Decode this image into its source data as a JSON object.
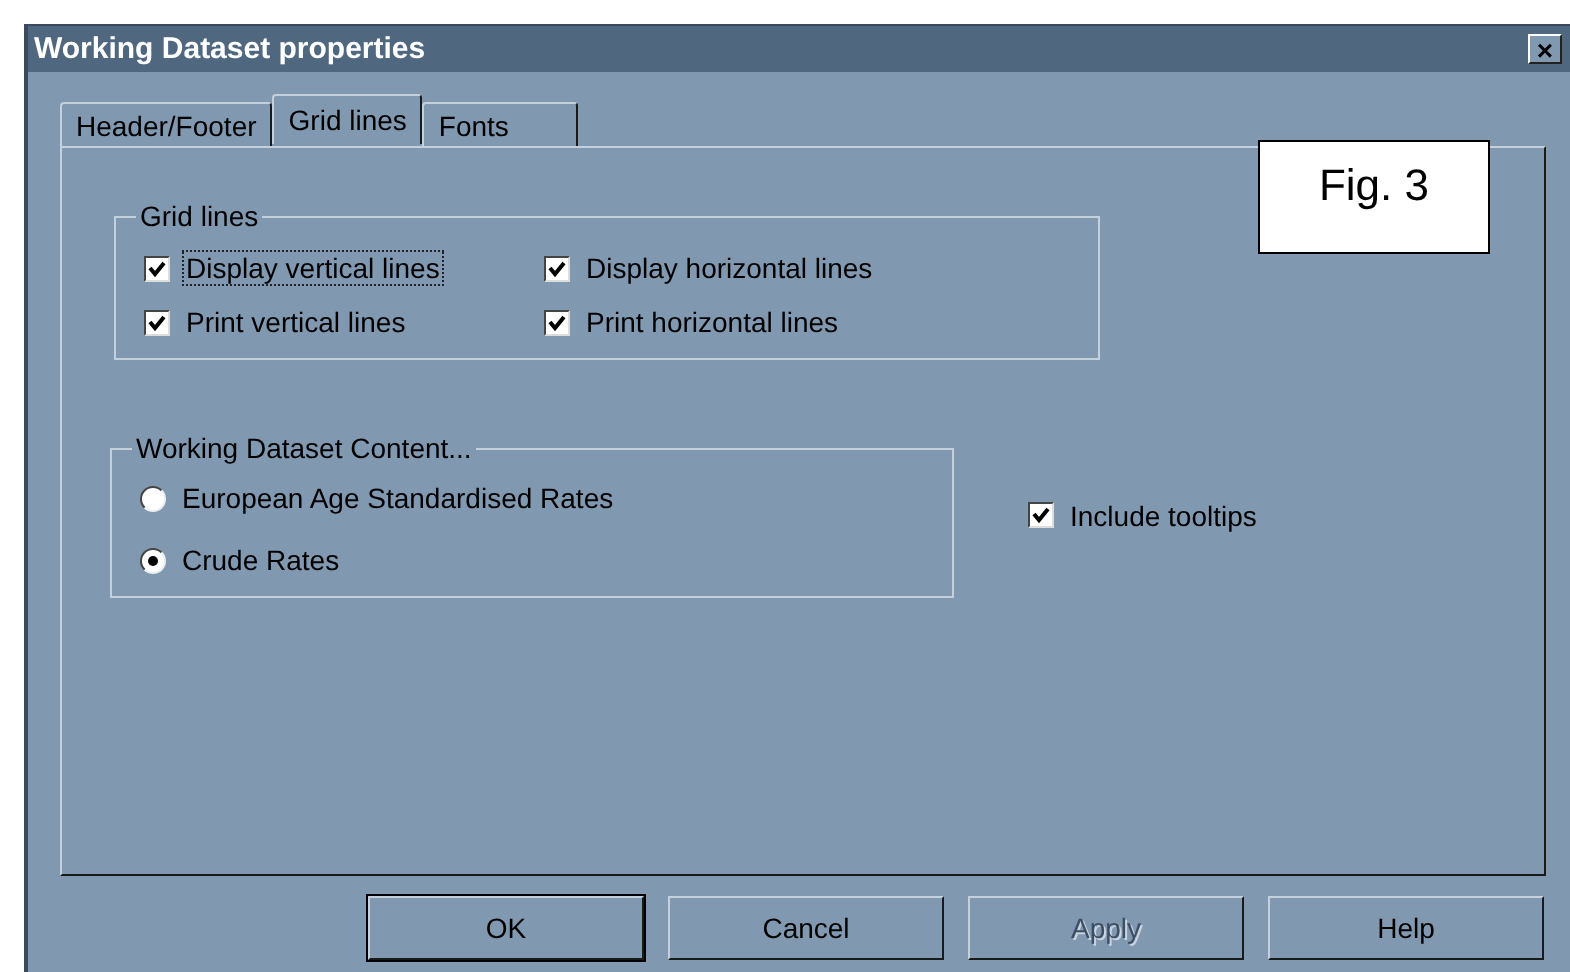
{
  "window": {
    "title": "Working Dataset properties",
    "close": "×"
  },
  "tabs": [
    {
      "label": "Header/Footer",
      "selected": false
    },
    {
      "label": "Grid lines",
      "selected": true
    },
    {
      "label": "Fonts",
      "selected": false
    }
  ],
  "figure_label": "Fig. 3",
  "grid_lines": {
    "title": "Grid lines",
    "options": [
      {
        "label": "Display vertical lines",
        "checked": true,
        "focused": true
      },
      {
        "label": "Display horizontal lines",
        "checked": true,
        "focused": false
      },
      {
        "label": "Print vertical lines",
        "checked": true,
        "focused": false
      },
      {
        "label": "Print horizontal lines",
        "checked": true,
        "focused": false
      }
    ]
  },
  "content": {
    "title": "Working Dataset Content...",
    "options": [
      {
        "label": "European Age Standardised Rates",
        "selected": false
      },
      {
        "label": "Crude Rates",
        "selected": true
      }
    ]
  },
  "include_tooltips": {
    "label": "Include tooltips",
    "checked": true
  },
  "buttons": [
    {
      "label": "OK",
      "disabled": false,
      "default": true
    },
    {
      "label": "Cancel",
      "disabled": false,
      "default": false
    },
    {
      "label": "Apply",
      "disabled": true,
      "default": false
    },
    {
      "label": "Help",
      "disabled": false,
      "default": false
    }
  ]
}
